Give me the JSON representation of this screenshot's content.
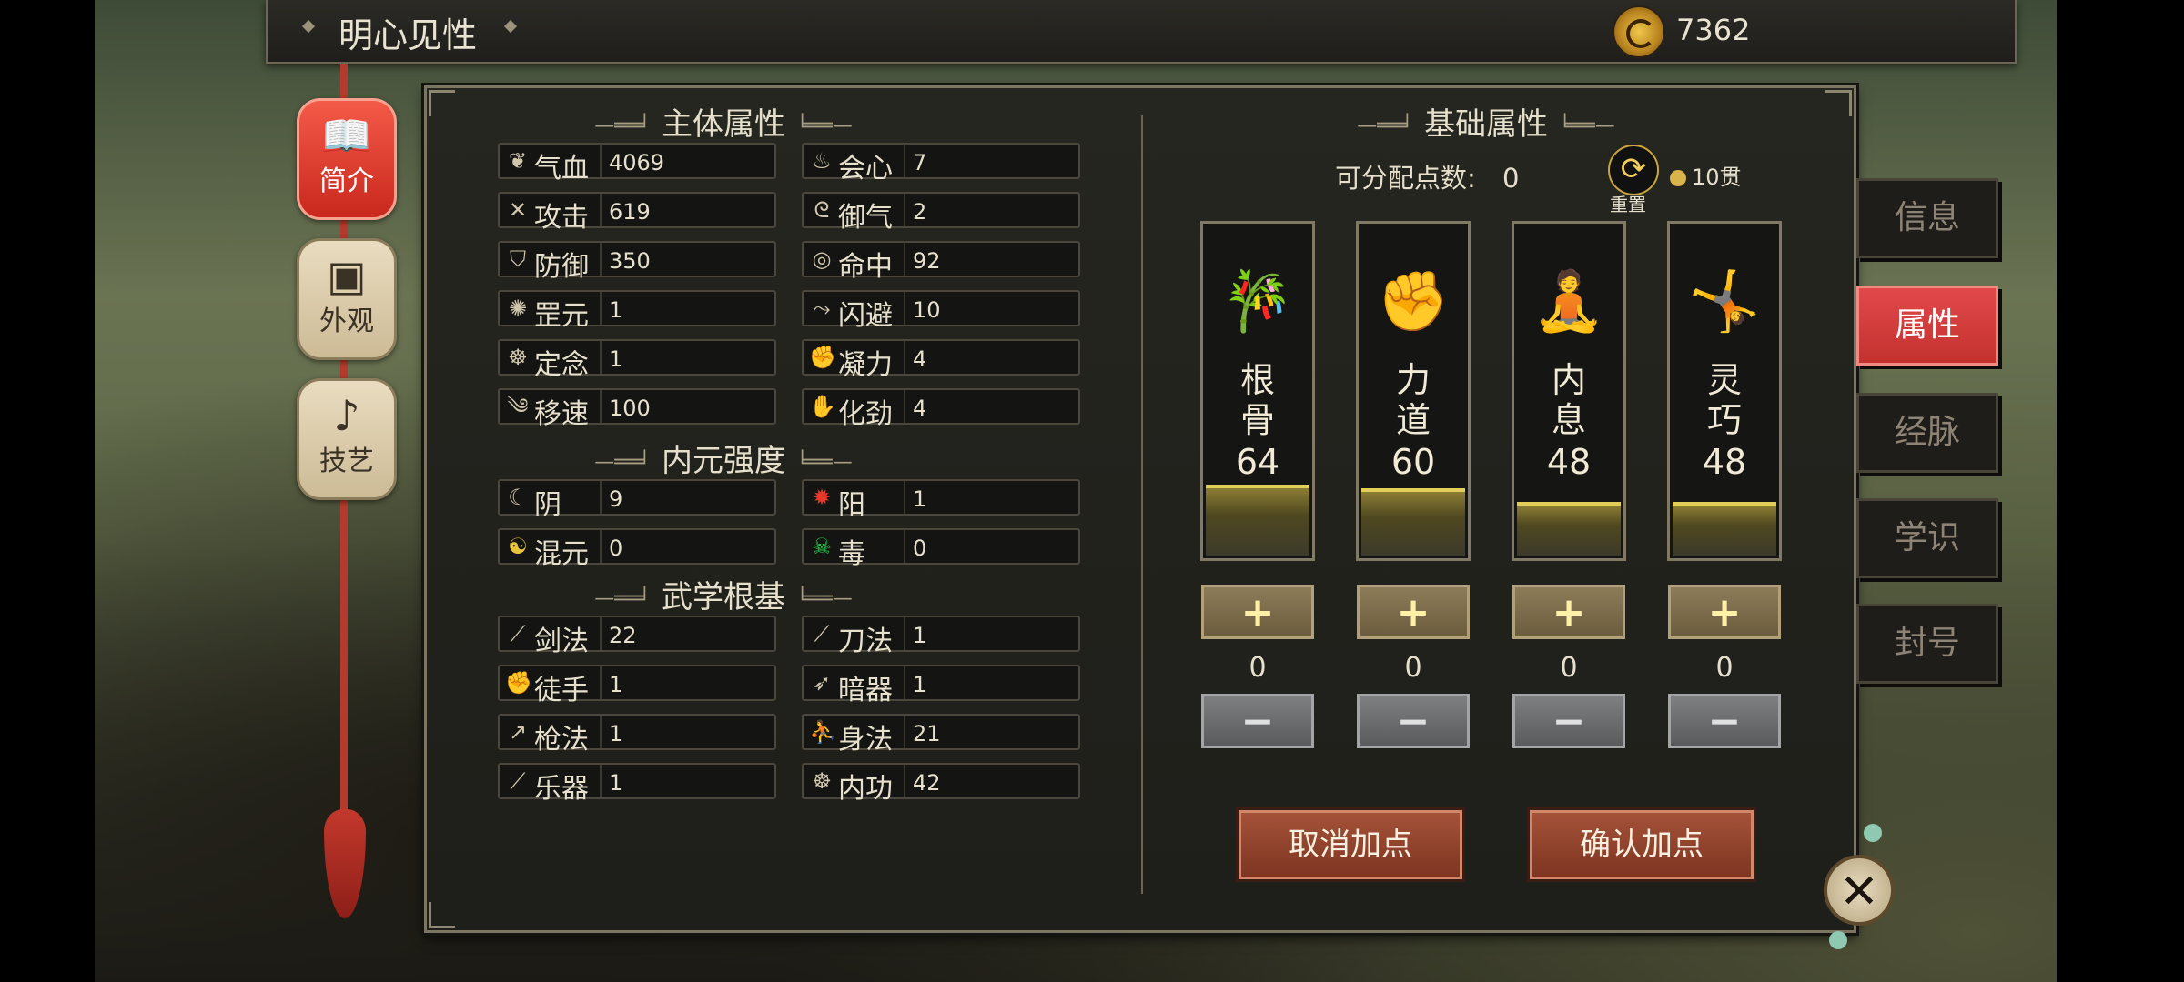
{
  "header": {
    "title": "明心见性",
    "currency_value": "7362",
    "currency_icon": "yin-yang-coin-icon"
  },
  "left_tabs": [
    {
      "label": "简介",
      "icon": "book-icon",
      "active": true
    },
    {
      "label": "外观",
      "icon": "outfit-icon",
      "active": false
    },
    {
      "label": "技艺",
      "icon": "pipa-instrument-icon",
      "active": false
    }
  ],
  "sections": {
    "main": "主体属性",
    "inner": "内元强度",
    "martial": "武学根基",
    "base": "基础属性"
  },
  "main_stats": [
    {
      "name": "气血",
      "value": "4069",
      "icon": "leaf-icon"
    },
    {
      "name": "会心",
      "value": "7",
      "icon": "flame-icon"
    },
    {
      "name": "攻击",
      "value": "619",
      "icon": "crossed-swords-icon"
    },
    {
      "name": "御气",
      "value": "2",
      "icon": "swirl-icon"
    },
    {
      "name": "防御",
      "value": "350",
      "icon": "shield-icon"
    },
    {
      "name": "命中",
      "value": "92",
      "icon": "target-icon"
    },
    {
      "name": "罡元",
      "value": "1",
      "icon": "orb-icon"
    },
    {
      "name": "闪避",
      "value": "10",
      "icon": "dodge-icon"
    },
    {
      "name": "定念",
      "value": "1",
      "icon": "meditation-icon"
    },
    {
      "name": "凝力",
      "value": "4",
      "icon": "fist-icon"
    },
    {
      "name": "移速",
      "value": "100",
      "icon": "wing-icon"
    },
    {
      "name": "化劲",
      "value": "4",
      "icon": "palm-icon"
    }
  ],
  "inner_stats": [
    {
      "name": "阴",
      "value": "9",
      "icon": "moon-icon"
    },
    {
      "name": "阳",
      "value": "1",
      "icon": "sun-icon"
    },
    {
      "name": "混元",
      "value": "0",
      "icon": "taiji-icon"
    },
    {
      "name": "毒",
      "value": "0",
      "icon": "skull-icon"
    }
  ],
  "martial_stats": [
    {
      "name": "剑法",
      "value": "22",
      "icon": "sword-icon"
    },
    {
      "name": "刀法",
      "value": "1",
      "icon": "blade-icon"
    },
    {
      "name": "徒手",
      "value": "1",
      "icon": "fist-icon"
    },
    {
      "name": "暗器",
      "value": "1",
      "icon": "dart-icon"
    },
    {
      "name": "枪法",
      "value": "1",
      "icon": "spear-icon"
    },
    {
      "name": "身法",
      "value": "21",
      "icon": "running-icon"
    },
    {
      "name": "乐器",
      "value": "1",
      "icon": "flute-icon"
    },
    {
      "name": "内功",
      "value": "42",
      "icon": "meditation-icon"
    }
  ],
  "allocation": {
    "label": "可分配点数:",
    "points": "0",
    "reset_label": "重置",
    "reset_cost": "10贯"
  },
  "base_attributes": [
    {
      "name_top": "根",
      "name_bottom": "骨",
      "value": "64",
      "allocated": "0",
      "fill_fraction": 0.2,
      "icon": "bamboo-icon",
      "glyph": "🎋"
    },
    {
      "name_top": "力",
      "name_bottom": "道",
      "value": "60",
      "allocated": "0",
      "fill_fraction": 0.19,
      "icon": "fist-icon",
      "glyph": "✊"
    },
    {
      "name_top": "内",
      "name_bottom": "息",
      "value": "48",
      "allocated": "0",
      "fill_fraction": 0.15,
      "icon": "meditation-icon",
      "glyph": "🧘"
    },
    {
      "name_top": "灵",
      "name_bottom": "巧",
      "value": "48",
      "allocated": "0",
      "fill_fraction": 0.15,
      "icon": "dancer-icon",
      "glyph": "🤸"
    }
  ],
  "buttons": {
    "cancel": "取消加点",
    "confirm": "确认加点",
    "plus": "+",
    "minus": "−",
    "close": "✕"
  },
  "right_tabs": [
    {
      "label": "信息",
      "active": false
    },
    {
      "label": "属性",
      "active": true
    },
    {
      "label": "经脉",
      "active": false
    },
    {
      "label": "学识",
      "active": false
    },
    {
      "label": "封号",
      "active": false
    }
  ]
}
